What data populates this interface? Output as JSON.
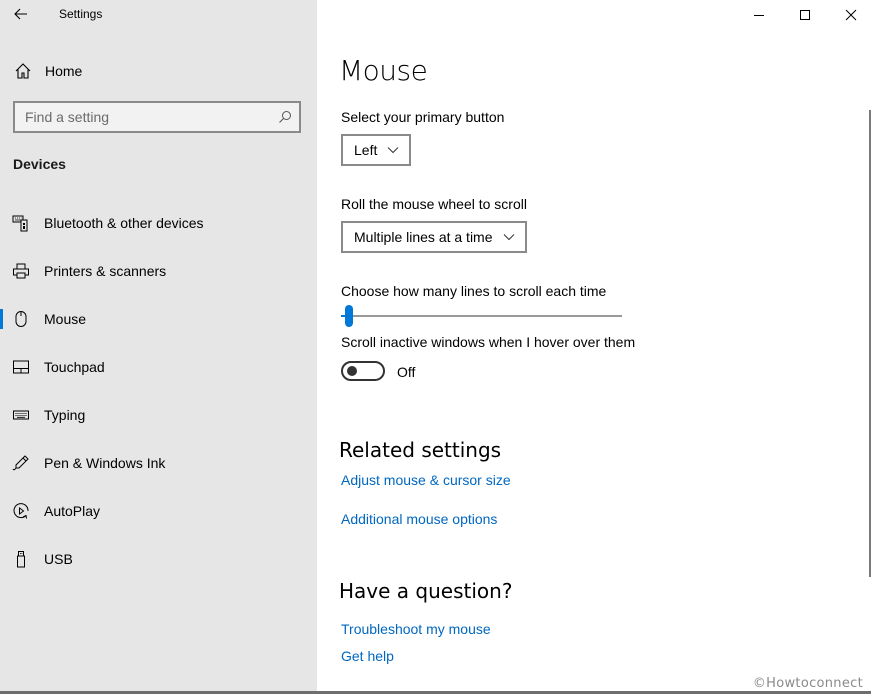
{
  "window": {
    "title": "Settings",
    "controls": {
      "minimize": "minimize",
      "maximize": "maximize",
      "close": "close"
    }
  },
  "sidebar": {
    "home_label": "Home",
    "search": {
      "placeholder": "Find a setting",
      "value": ""
    },
    "section_label": "Devices",
    "items": [
      {
        "label": "Bluetooth & other devices",
        "icon": "bluetooth-devices-icon",
        "selected": false
      },
      {
        "label": "Printers & scanners",
        "icon": "printer-icon",
        "selected": false
      },
      {
        "label": "Mouse",
        "icon": "mouse-icon",
        "selected": true
      },
      {
        "label": "Touchpad",
        "icon": "touchpad-icon",
        "selected": false
      },
      {
        "label": "Typing",
        "icon": "keyboard-icon",
        "selected": false
      },
      {
        "label": "Pen & Windows Ink",
        "icon": "pen-icon",
        "selected": false
      },
      {
        "label": "AutoPlay",
        "icon": "autoplay-icon",
        "selected": false
      },
      {
        "label": "USB",
        "icon": "usb-icon",
        "selected": false
      }
    ]
  },
  "main": {
    "title": "Mouse",
    "primary_button": {
      "label": "Select your primary button",
      "value": "Left"
    },
    "wheel_scroll": {
      "label": "Roll the mouse wheel to scroll",
      "value": "Multiple lines at a time"
    },
    "lines_slider": {
      "label": "Choose how many lines to scroll each time",
      "value_fraction": 0.03
    },
    "inactive_scroll": {
      "label": "Scroll inactive windows when I hover over them",
      "state": "Off",
      "on": false
    },
    "related": {
      "heading": "Related settings",
      "links": [
        "Adjust mouse & cursor size",
        "Additional mouse options"
      ]
    },
    "question": {
      "heading": "Have a question?",
      "links": [
        "Troubleshoot my mouse",
        "Get help"
      ]
    }
  },
  "accent_color": "#0078d7",
  "link_color": "#0067c0",
  "watermark": "©Howtoconnect"
}
